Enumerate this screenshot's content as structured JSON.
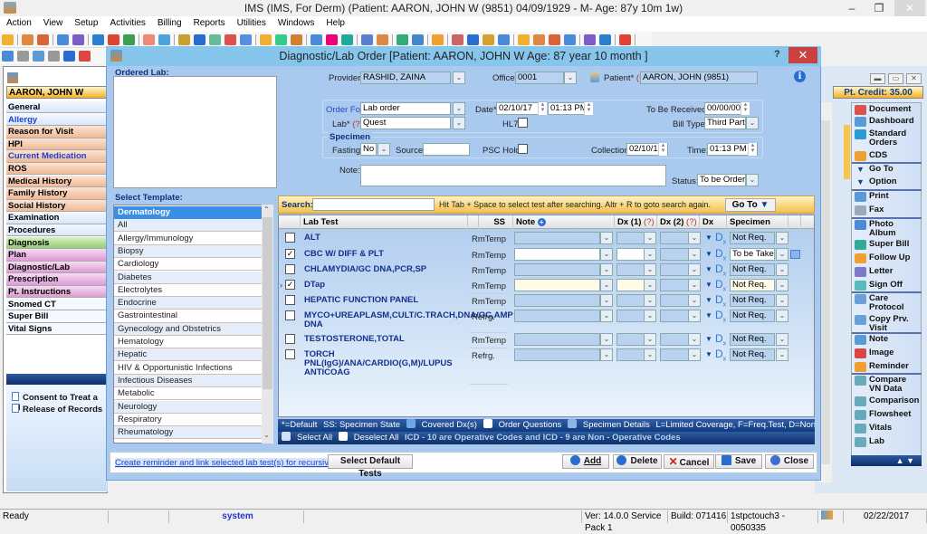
{
  "app": {
    "title": "IMS (IMS, For Derm)    (Patient: AARON, JOHN W (9851) 04/09/1929 - M- Age: 87y 10m 1w)",
    "window_controls": {
      "minimize": "–",
      "restore": "❐",
      "close": "✕"
    }
  },
  "menu": [
    "Action",
    "View",
    "Setup",
    "Activities",
    "Billing",
    "Reports",
    "Utilities",
    "Windows",
    "Help"
  ],
  "patient_window": {
    "patient_name": "AARON, JOHN W",
    "pt_credit": "Pt. Credit: 35.00",
    "nav_items": [
      {
        "label": "General",
        "style": "blue",
        "link": false
      },
      {
        "label": "Allergy",
        "style": "blue",
        "link": true
      },
      {
        "label": "Reason for Visit",
        "style": "orange",
        "link": false
      },
      {
        "label": "HPI",
        "style": "orange",
        "link": false
      },
      {
        "label": "Current Medication",
        "style": "orange",
        "link": true
      },
      {
        "label": "ROS",
        "style": "orange",
        "link": false
      },
      {
        "label": "Medical History",
        "style": "orange",
        "link": false
      },
      {
        "label": "Family History",
        "style": "orange",
        "link": false
      },
      {
        "label": "Social History",
        "style": "orange",
        "link": false
      },
      {
        "label": "Examination",
        "style": "blue",
        "link": false
      },
      {
        "label": "Procedures",
        "style": "blue",
        "link": false
      },
      {
        "label": "Diagnosis",
        "style": "green",
        "link": false
      },
      {
        "label": "Plan",
        "style": "pink",
        "link": false
      },
      {
        "label": "Diagnostic/Lab",
        "style": "pink",
        "link": false
      },
      {
        "label": "Prescription",
        "style": "pink",
        "link": false
      },
      {
        "label": "Pt. Instructions",
        "style": "pink",
        "link": false
      },
      {
        "label": "Snomed CT",
        "style": "white",
        "link": false
      },
      {
        "label": "Super Bill",
        "style": "white",
        "link": false
      },
      {
        "label": "Vital Signs",
        "style": "white",
        "link": false
      }
    ],
    "documents": [
      "Consent to Treat a Cl",
      "Release of Records"
    ],
    "right_panel": [
      {
        "label": "Document",
        "icon": "document-icon"
      },
      {
        "label": "Dashboard",
        "icon": "dashboard-icon"
      },
      {
        "label": "Standard Orders",
        "icon": "standard-orders-icon"
      },
      {
        "label": "CDS",
        "icon": "cds-icon"
      },
      {
        "label": "Go To",
        "icon": "triangle-down-icon"
      },
      {
        "label": "Option",
        "icon": "triangle-down-icon"
      },
      {
        "label": "Print",
        "icon": "print-icon"
      },
      {
        "label": "Fax",
        "icon": "fax-icon"
      },
      {
        "label": "Photo Album",
        "icon": "photo-album-icon"
      },
      {
        "label": "Super Bill",
        "icon": "super-bill-icon"
      },
      {
        "label": "Follow Up",
        "icon": "follow-up-icon"
      },
      {
        "label": "Letter",
        "icon": "letter-icon"
      },
      {
        "label": "Sign Off",
        "icon": "sign-off-icon"
      },
      {
        "label": "Care Protocol",
        "icon": "care-protocol-icon"
      },
      {
        "label": "Copy Prv. Visit",
        "icon": "copy-visit-icon"
      },
      {
        "label": "Note",
        "icon": "note-icon"
      },
      {
        "label": "Image",
        "icon": "image-icon"
      },
      {
        "label": "Reminder",
        "icon": "reminder-icon"
      },
      {
        "label": "Compare VN Data",
        "icon": "compare-icon"
      },
      {
        "label": "Comparison",
        "icon": "comparison-icon"
      },
      {
        "label": "Flowsheet",
        "icon": "flowsheet-icon"
      },
      {
        "label": "Vitals",
        "icon": "vitals-icon"
      },
      {
        "label": "Lab",
        "icon": "lab-icon"
      }
    ]
  },
  "dialog": {
    "title": "Diagnostic/Lab Order  [Patient: AARON, JOHN W  Age: 87 year 10 month ]",
    "help": "?",
    "close": "✕",
    "ordered_lab_label": "Ordered Lab:",
    "provider_label": "Provider*",
    "provider_value": "RASHID, ZAINA",
    "office_label": "Office:",
    "office_value": "0001",
    "patient_label": "Patient*",
    "patient_q": "(?)",
    "patient_value": "AARON, JOHN  (9851)",
    "order_for_label": "Order For*",
    "order_for_value": "Lab order",
    "date_label": "Date*",
    "date_value": "02/10/17",
    "time_value": "01:13 PM",
    "to_be_received_label": "To Be Received:",
    "to_be_received_value": "00/00/00",
    "lab_label": "Lab*",
    "lab_q": "(?)",
    "lab_value": "Quest",
    "hl7_label": "HL7:",
    "hl7_checked": false,
    "bill_type_label": "Bill Type:",
    "bill_type_value": "Third Party",
    "specimen_label": "Specimen",
    "fasting_label": "Fasting:",
    "fasting_value": "No",
    "source_label": "Source:",
    "source_value": "",
    "psc_hold_label": "PSC Hold:",
    "psc_hold_checked": false,
    "collection_label": "Collection:",
    "collection_value": "02/10/17",
    "coll_time_label": "Time:",
    "coll_time_value": "01:13 PM",
    "note_label": "Note:",
    "note_value": "",
    "status_label": "Status:",
    "status_value": "To be Ordered",
    "select_template_label": "Select Template:",
    "templates": [
      "Dermatology",
      "All",
      "Allergy/Immunology",
      "Biopsy",
      "Cardiology",
      "Diabetes",
      "Electrolytes",
      "Endocrine",
      "Gastrointestinal",
      "Gynecology and Obstetrics",
      "Hematology",
      "Hepatic",
      "HIV & Opportunistic Infections",
      "Infectious Diseases",
      "Metabolic",
      "Neurology",
      "Respiratory",
      "Rheumatology"
    ],
    "selected_template": "Dermatology",
    "search_label": "Search:",
    "search_value": "",
    "search_hint": "Hit Tab + Space to select test after searching. Altr + R to goto search again.",
    "goto_label": "Go To",
    "columns": {
      "lab_test": "Lab Test",
      "ss": "SS",
      "note": "Note",
      "dx1": "Dx (1)",
      "dx1_q": "(?)",
      "dx2": "Dx (2)",
      "dx2_q": "(?)",
      "dx": "Dx",
      "specimen": "Specimen"
    },
    "tests": [
      {
        "name": "ALT",
        "ss": "RmTemp",
        "checked": false,
        "specimen": "Not Req.",
        "current": false
      },
      {
        "name": "CBC W/ DIFF & PLT",
        "ss": "RmTemp",
        "checked": true,
        "specimen": "To be Taken",
        "current": false
      },
      {
        "name": "CHLAMYDIA/GC DNA,PCR,SP",
        "ss": "RmTemp",
        "checked": false,
        "specimen": "Not Req.",
        "current": false
      },
      {
        "name": "DTap",
        "ss": "RmTemp",
        "checked": true,
        "specimen": "Not Req.",
        "current": true
      },
      {
        "name": "HEPATIC FUNCTION PANEL",
        "ss": "RmTemp",
        "checked": false,
        "specimen": "Not Req.",
        "current": false
      },
      {
        "name": "MYCO+UREAPLASM,CULT/C.TRACH,DNA/GC,AMP DNA",
        "ss": "Refrg.",
        "checked": false,
        "specimen": "Not Req.",
        "current": false
      },
      {
        "name": "TESTOSTERONE,TOTAL",
        "ss": "RmTemp",
        "checked": false,
        "specimen": "Not Req.",
        "current": false
      },
      {
        "name": "TORCH PNL(IgG)/ANA/CARDIO(G,M)/LUPUS ANTICOAG",
        "ss": "Refrg.",
        "checked": false,
        "specimen": "Not Req.",
        "current": false
      }
    ],
    "dx_label": "D",
    "dx_sub": "x",
    "legend1": {
      "default": "*=Default",
      "ss": "SS: Specimen State",
      "covered": "Covered Dx(s)",
      "questions": "Order Questions",
      "specimen_details": "Specimen Details",
      "codes": "L=Limited Coverage, F=Freq.Test, D=Non FDA"
    },
    "legend2": {
      "select_all": "Select All",
      "deselect_all": "Deselect All",
      "icd_note": "ICD - 10 are Operative Codes and ICD - 9 are Non - Operative Codes"
    },
    "recursive_link": "Create reminder and link selected lab test(s) for recursive order.",
    "select_default_tests": "Select Default Tests",
    "buttons": {
      "add": "Add",
      "delete": "Delete",
      "cancel": "Cancel",
      "save": "Save",
      "close": "Close"
    }
  },
  "status_bar": {
    "ready": "Ready",
    "user": "system",
    "version": "Ver: 14.0.0 Service Pack 1",
    "build": "Build: 071416",
    "server": "1stpctouch3 - 0050335",
    "date": "02/22/2017"
  },
  "colors": {
    "accent": "#86c5ec",
    "dialog_bg": "#a9c9ef",
    "link": "#1d45c9",
    "test_name": "#14308c",
    "close_red": "#c9423f"
  }
}
